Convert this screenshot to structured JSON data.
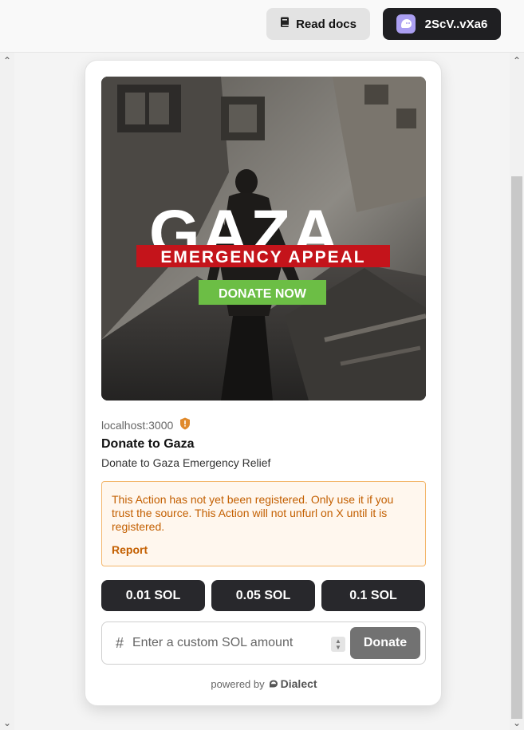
{
  "header": {
    "docs_label": "Read docs",
    "wallet_label": "2ScV..vXa6"
  },
  "card": {
    "image": {
      "headline": "GAZA",
      "subheadline": "EMERGENCY APPEAL",
      "cta": "DONATE NOW"
    },
    "host": "localhost:3000",
    "title": "Donate to Gaza",
    "description": "Donate to Gaza Emergency Relief",
    "warning": {
      "text": "This Action has not yet been registered. Only use it if you trust the source. This Action will not unfurl on X until it is registered.",
      "report_label": "Report"
    },
    "amounts": [
      "0.01 SOL",
      "0.05 SOL",
      "0.1 SOL"
    ],
    "custom": {
      "placeholder": "Enter a custom SOL amount",
      "submit_label": "Donate"
    },
    "footer": {
      "powered_by": "powered by",
      "brand": "Dialect"
    }
  },
  "colors": {
    "warning_text": "#c35f00",
    "warning_bg": "#fff7ee",
    "amount_button": "#28282c",
    "donate_button": "#727272",
    "appeal_red": "#c4141b",
    "donate_green": "#6cbe45",
    "wallet_avatar": "#ab9ff2"
  }
}
